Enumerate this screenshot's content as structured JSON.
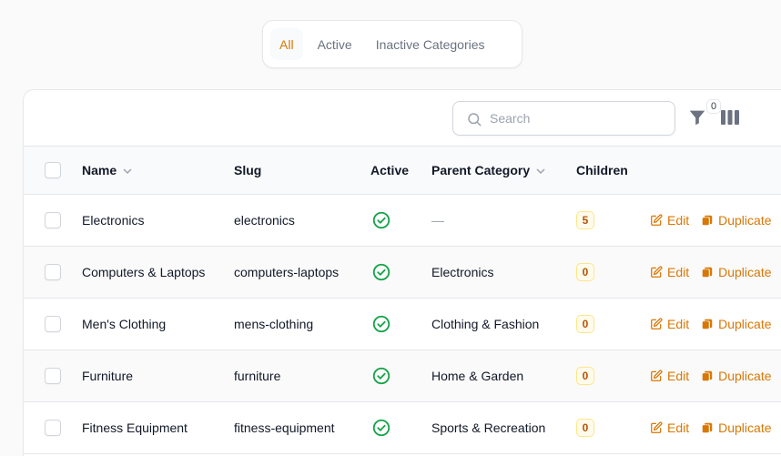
{
  "tabs": [
    {
      "label": "All",
      "active": true
    },
    {
      "label": "Active",
      "active": false
    },
    {
      "label": "Inactive Categories",
      "active": false
    }
  ],
  "toolbar": {
    "search_placeholder": "Search",
    "filter_count": "0"
  },
  "table": {
    "columns": {
      "name": "Name",
      "slug": "Slug",
      "active": "Active",
      "parent": "Parent Category",
      "children": "Children"
    },
    "actions": {
      "edit": "Edit",
      "duplicate": "Duplicate"
    },
    "rows": [
      {
        "name": "Electronics",
        "slug": "electronics",
        "active": true,
        "parent": "—",
        "children": "5"
      },
      {
        "name": "Computers & Laptops",
        "slug": "computers-laptops",
        "active": true,
        "parent": "Electronics",
        "children": "0"
      },
      {
        "name": "Men's Clothing",
        "slug": "mens-clothing",
        "active": true,
        "parent": "Clothing & Fashion",
        "children": "0"
      },
      {
        "name": "Furniture",
        "slug": "furniture",
        "active": true,
        "parent": "Home & Garden",
        "children": "0"
      },
      {
        "name": "Fitness Equipment",
        "slug": "fitness-equipment",
        "active": true,
        "parent": "Sports & Recreation",
        "children": "0"
      }
    ]
  },
  "colors": {
    "accent": "#d97706",
    "success": "#16a34a",
    "border": "#e5e7eb"
  }
}
